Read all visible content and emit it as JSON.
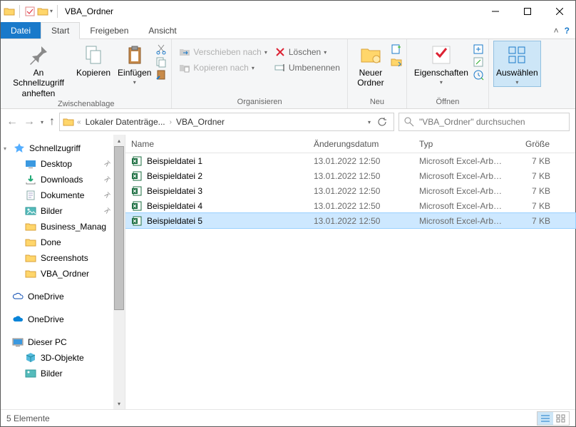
{
  "window": {
    "title": "VBA_Ordner"
  },
  "tabs": {
    "file": "Datei",
    "start": "Start",
    "share": "Freigeben",
    "view": "Ansicht"
  },
  "ribbon": {
    "clipboard": {
      "pin": "An Schnellzugriff anheften",
      "copy": "Kopieren",
      "paste": "Einfügen",
      "label": "Zwischenablage"
    },
    "organize": {
      "move": "Verschieben nach",
      "copyto": "Kopieren nach",
      "delete": "Löschen",
      "rename": "Umbenennen",
      "label": "Organisieren"
    },
    "new": {
      "folder": "Neuer Ordner",
      "label": "Neu"
    },
    "open": {
      "props": "Eigenschaften",
      "label": "Öffnen"
    },
    "select": {
      "select": "Auswählen",
      "label": ""
    }
  },
  "breadcrumb": {
    "drive": "Lokaler Datenträge...",
    "folder": "VBA_Ordner"
  },
  "search": {
    "placeholder": "\"VBA_Ordner\" durchsuchen"
  },
  "tree": {
    "quick": "Schnellzugriff",
    "desktop": "Desktop",
    "downloads": "Downloads",
    "documents": "Dokumente",
    "pictures": "Bilder",
    "bm": "Business_Manag",
    "done": "Done",
    "screenshots": "Screenshots",
    "vba": "VBA_Ordner",
    "od1": "OneDrive",
    "od2": "OneDrive",
    "pc": "Dieser PC",
    "obj3d": "3D-Objekte",
    "pics2": "Bilder"
  },
  "columns": {
    "name": "Name",
    "date": "Änderungsdatum",
    "type": "Typ",
    "size": "Größe"
  },
  "files": [
    {
      "name": "Beispieldatei 1",
      "date": "13.01.2022 12:50",
      "type": "Microsoft Excel-Arbe...",
      "size": "7 KB",
      "sel": false
    },
    {
      "name": "Beispieldatei 2",
      "date": "13.01.2022 12:50",
      "type": "Microsoft Excel-Arbe...",
      "size": "7 KB",
      "sel": false
    },
    {
      "name": "Beispieldatei 3",
      "date": "13.01.2022 12:50",
      "type": "Microsoft Excel-Arbe...",
      "size": "7 KB",
      "sel": false
    },
    {
      "name": "Beispieldatei 4",
      "date": "13.01.2022 12:50",
      "type": "Microsoft Excel-Arbe...",
      "size": "7 KB",
      "sel": false
    },
    {
      "name": "Beispieldatei 5",
      "date": "13.01.2022 12:50",
      "type": "Microsoft Excel-Arbe...",
      "size": "7 KB",
      "sel": true
    }
  ],
  "status": {
    "count": "5 Elemente"
  }
}
